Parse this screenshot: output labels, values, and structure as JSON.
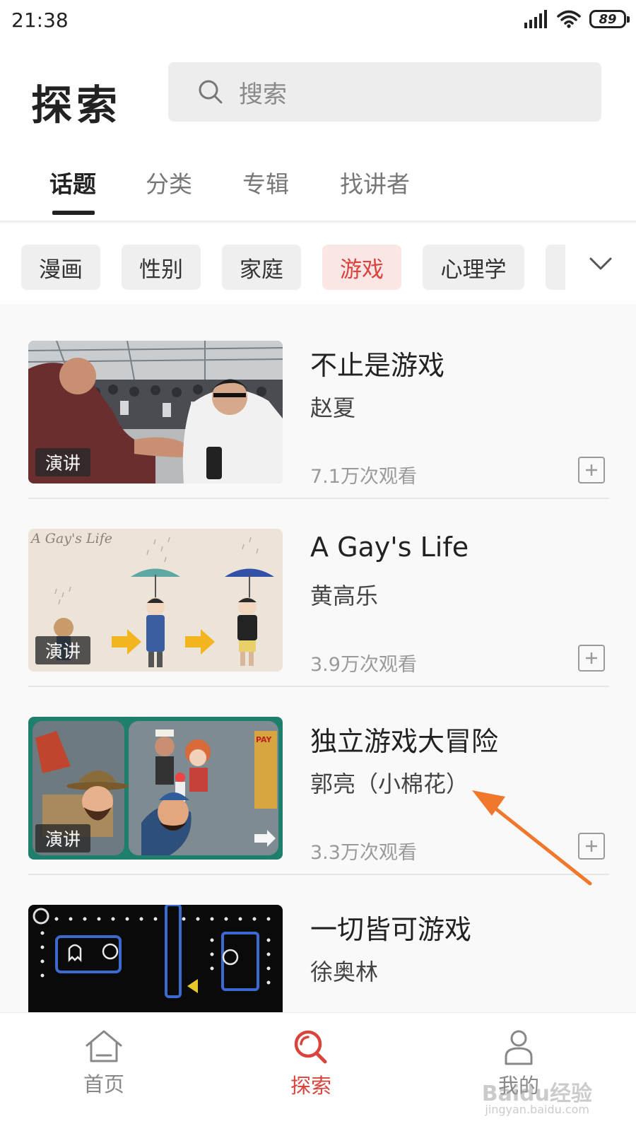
{
  "status_bar": {
    "time": "21:38",
    "battery": "89",
    "icons": [
      "signal-icon",
      "wifi-icon",
      "battery-icon"
    ]
  },
  "header": {
    "title": "探索",
    "search_placeholder": "搜索"
  },
  "tabs": [
    {
      "label": "话题",
      "active": true
    },
    {
      "label": "分类",
      "active": false
    },
    {
      "label": "专辑",
      "active": false
    },
    {
      "label": "找讲者",
      "active": false
    }
  ],
  "chips": [
    {
      "label": "漫画",
      "active": false
    },
    {
      "label": "性别",
      "active": false
    },
    {
      "label": "家庭",
      "active": false
    },
    {
      "label": "游戏",
      "active": true
    },
    {
      "label": "心理学",
      "active": false
    }
  ],
  "items": [
    {
      "title": "不止是游戏",
      "author": "赵夏",
      "views": "7.1万次观看",
      "badge": "演讲"
    },
    {
      "title": "A Gay's Life",
      "author": "黄高乐",
      "views": "3.9万次观看",
      "badge": "演讲",
      "thumb_caption": "A Gay's Life"
    },
    {
      "title": "独立游戏大冒险",
      "author": "郭亮（小棉花）",
      "views": "3.3万次观看",
      "badge": "演讲"
    },
    {
      "title": "一切皆可游戏",
      "author": "徐奥林"
    }
  ],
  "bottom_nav": [
    {
      "label": "首页",
      "icon": "home-icon",
      "active": false
    },
    {
      "label": "探索",
      "icon": "search-icon",
      "active": true
    },
    {
      "label": "我的",
      "icon": "profile-icon",
      "active": false
    }
  ],
  "colors": {
    "accent": "#d9443c",
    "annotation_arrow": "#f0782c"
  },
  "watermark": {
    "text": "Baidu经验",
    "sub": "jingyan.baidu.com"
  }
}
